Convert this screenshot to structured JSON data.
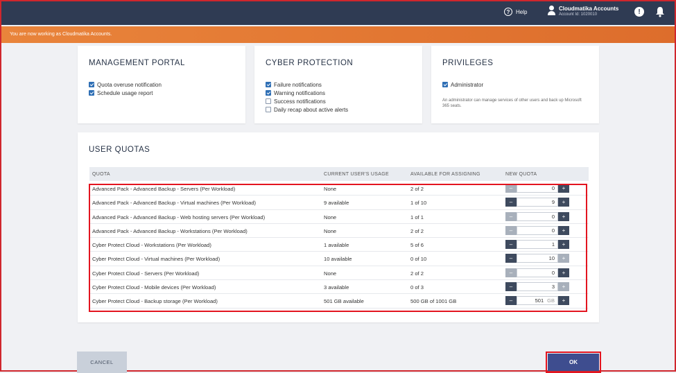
{
  "topbar": {
    "help_label": "Help",
    "account_name": "Cloudmatika Accounts",
    "account_id": "Account Id: 1020010"
  },
  "banner": {
    "text": "You are now working as Cloudmatika Accounts."
  },
  "management": {
    "title": "MANAGEMENT PORTAL",
    "items": [
      {
        "label": "Quota overuse notification",
        "checked": true
      },
      {
        "label": "Schedule usage report",
        "checked": true
      }
    ]
  },
  "cyber": {
    "title": "CYBER PROTECTION",
    "items": [
      {
        "label": "Failure notifications",
        "checked": true
      },
      {
        "label": "Warning notifications",
        "checked": true
      },
      {
        "label": "Success notifications",
        "checked": false
      },
      {
        "label": "Daily recap about active alerts",
        "checked": false
      }
    ]
  },
  "privileges": {
    "title": "PRIVILEGES",
    "items": [
      {
        "label": "Administrator",
        "checked": true
      }
    ],
    "note": "An administrator can manage services of other users and back up Microsoft 365 seats."
  },
  "quotas": {
    "title": "USER QUOTAS",
    "columns": [
      "QUOTA",
      "CURRENT USER'S USAGE",
      "AVAILABLE FOR ASSIGNING",
      "NEW QUOTA"
    ],
    "rows": [
      {
        "name": "Advanced Pack - Advanced Backup - Servers (Per Workload)",
        "usage": "None",
        "available": "2 of 2",
        "value": "0",
        "unit": "",
        "minus_enabled": false,
        "plus_enabled": true
      },
      {
        "name": "Advanced Pack - Advanced Backup - Virtual machines (Per Workload)",
        "usage": "9 available",
        "available": "1 of 10",
        "value": "9",
        "unit": "",
        "minus_enabled": true,
        "plus_enabled": true
      },
      {
        "name": "Advanced Pack - Advanced Backup - Web hosting servers (Per Workload)",
        "usage": "None",
        "available": "1 of 1",
        "value": "0",
        "unit": "",
        "minus_enabled": false,
        "plus_enabled": true
      },
      {
        "name": "Advanced Pack - Advanced Backup - Workstations (Per Workload)",
        "usage": "None",
        "available": "2 of 2",
        "value": "0",
        "unit": "",
        "minus_enabled": false,
        "plus_enabled": true
      },
      {
        "name": "Cyber Protect Cloud - Workstations (Per Workload)",
        "usage": "1 available",
        "available": "5 of 6",
        "value": "1",
        "unit": "",
        "minus_enabled": true,
        "plus_enabled": true
      },
      {
        "name": "Cyber Protect Cloud - Virtual machines (Per Workload)",
        "usage": "10 available",
        "available": "0 of 10",
        "value": "10",
        "unit": "",
        "minus_enabled": true,
        "plus_enabled": false
      },
      {
        "name": "Cyber Protect Cloud - Servers (Per Workload)",
        "usage": "None",
        "available": "2 of 2",
        "value": "0",
        "unit": "",
        "minus_enabled": false,
        "plus_enabled": true
      },
      {
        "name": "Cyber Protect Cloud - Mobile devices (Per Workload)",
        "usage": "3 available",
        "available": "0 of 3",
        "value": "3",
        "unit": "",
        "minus_enabled": true,
        "plus_enabled": false
      },
      {
        "name": "Cyber Protect Cloud - Backup storage (Per Workload)",
        "usage": "501 GB available",
        "available": "500 GB of 1001 GB",
        "value": "501",
        "unit": "GB",
        "minus_enabled": true,
        "plus_enabled": true
      }
    ],
    "minus_symbol": "–",
    "plus_symbol": "+"
  },
  "footer": {
    "cancel_label": "CANCEL",
    "ok_label": "OK"
  },
  "colors": {
    "topbar": "#2f3b53",
    "banner": "#e17a34",
    "ok_button": "#3e4d8f",
    "highlight": "#e3141f"
  }
}
